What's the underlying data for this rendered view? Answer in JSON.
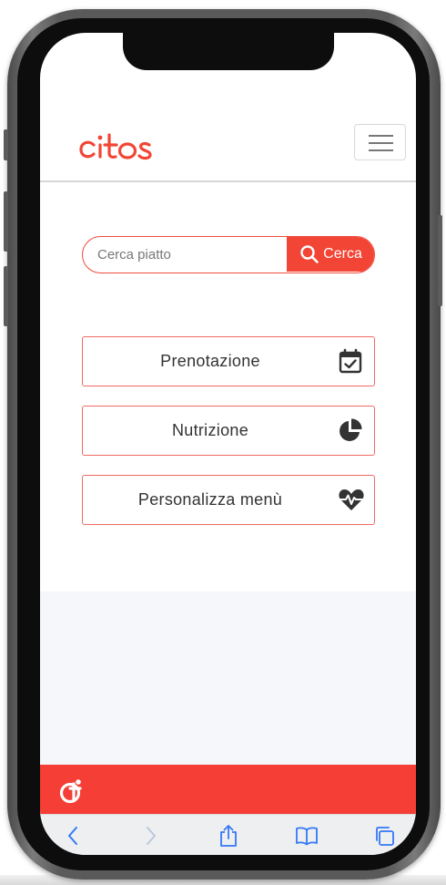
{
  "app": {
    "brand_name": "citos"
  },
  "search": {
    "placeholder": "Cerca piatto",
    "button_label": "Cerca"
  },
  "menu_cards": [
    {
      "label": "Prenotazione",
      "icon": "calendar-check-icon"
    },
    {
      "label": "Nutrizione",
      "icon": "pie-chart-icon"
    },
    {
      "label": "Personalizza menù",
      "icon": "heartbeat-icon"
    }
  ],
  "browser_toolbar": {
    "items": [
      "back-icon",
      "forward-icon",
      "share-icon",
      "bookmarks-icon",
      "tabs-icon"
    ]
  },
  "colors": {
    "accent": "#f24535",
    "card_border": "#ee6b63",
    "footer": "#f43e36",
    "ios_blue": "#3478f6"
  }
}
